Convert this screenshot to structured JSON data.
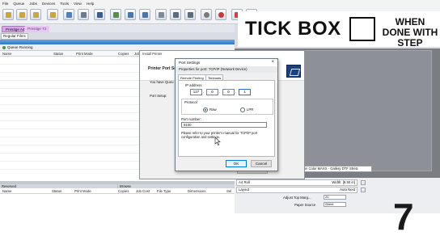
{
  "menu": [
    "File",
    "Queue",
    "Jobs",
    "Devices",
    "Tools",
    "View",
    "Help"
  ],
  "queue_tabs": [
    "Prestige A4",
    "Prestige T2"
  ],
  "sub_tab": "Regular Films",
  "queue_status": "Queue Running",
  "top_grid_headers": [
    "Name",
    "Status",
    "Print Mode",
    "Copies",
    "Job"
  ],
  "install_dialog": {
    "title": "Install Printer",
    "banner": "Printer Port Se",
    "question": "You have Queu",
    "setup_label": "Port Setup:",
    "next": "Next"
  },
  "port_dialog": {
    "title": "Port Settings",
    "close": "×",
    "subtitle": "Properties for port: TCP/IP (Network Device)",
    "tabs": [
      "Remote Printing",
      "Timeouts"
    ],
    "ip_label": "IP address",
    "ip": [
      "127",
      "0",
      "0",
      "1"
    ],
    "protocol_label": "Protocol",
    "protocol_options": [
      "Raw",
      "LPR"
    ],
    "protocol_selected": "Raw",
    "port_number_label": "Port number:",
    "port_number": "9100",
    "note": "Please refer to your printer's manual for TCP/IP port configuration and settings.",
    "ok": "OK",
    "cancel": "Cancel"
  },
  "bottom_panels": {
    "reserved": "Reserved",
    "browse": "Browse",
    "headers": [
      "Name",
      "Status",
      "Print Mode",
      "Copies",
      "Job Cost",
      "File Type",
      "Dimensions",
      "Sel"
    ]
  },
  "profile_dropdown": "... on Color MAXX - Gallery DTF Stretc",
  "properties": {
    "row1_label": "A4 Roll",
    "row1_value": "Width: [8.50 in]",
    "row2_label": "Layout",
    "row2_value": "Auto Nest",
    "adjust_label": "Adjust Top Marg...",
    "adjust_value": "20",
    "paper_source_label": "Paper Source",
    "paper_source_value": "Sheet"
  },
  "overlay": {
    "tick_text": "TICK BOX",
    "when_text": "WHEN DONE WITH STEP"
  },
  "step_number": "7",
  "colors": {
    "accent_blue": "#2d78c4",
    "queue_tab_purple": "#d8a8e6",
    "running_green": "#3b9a3b"
  }
}
